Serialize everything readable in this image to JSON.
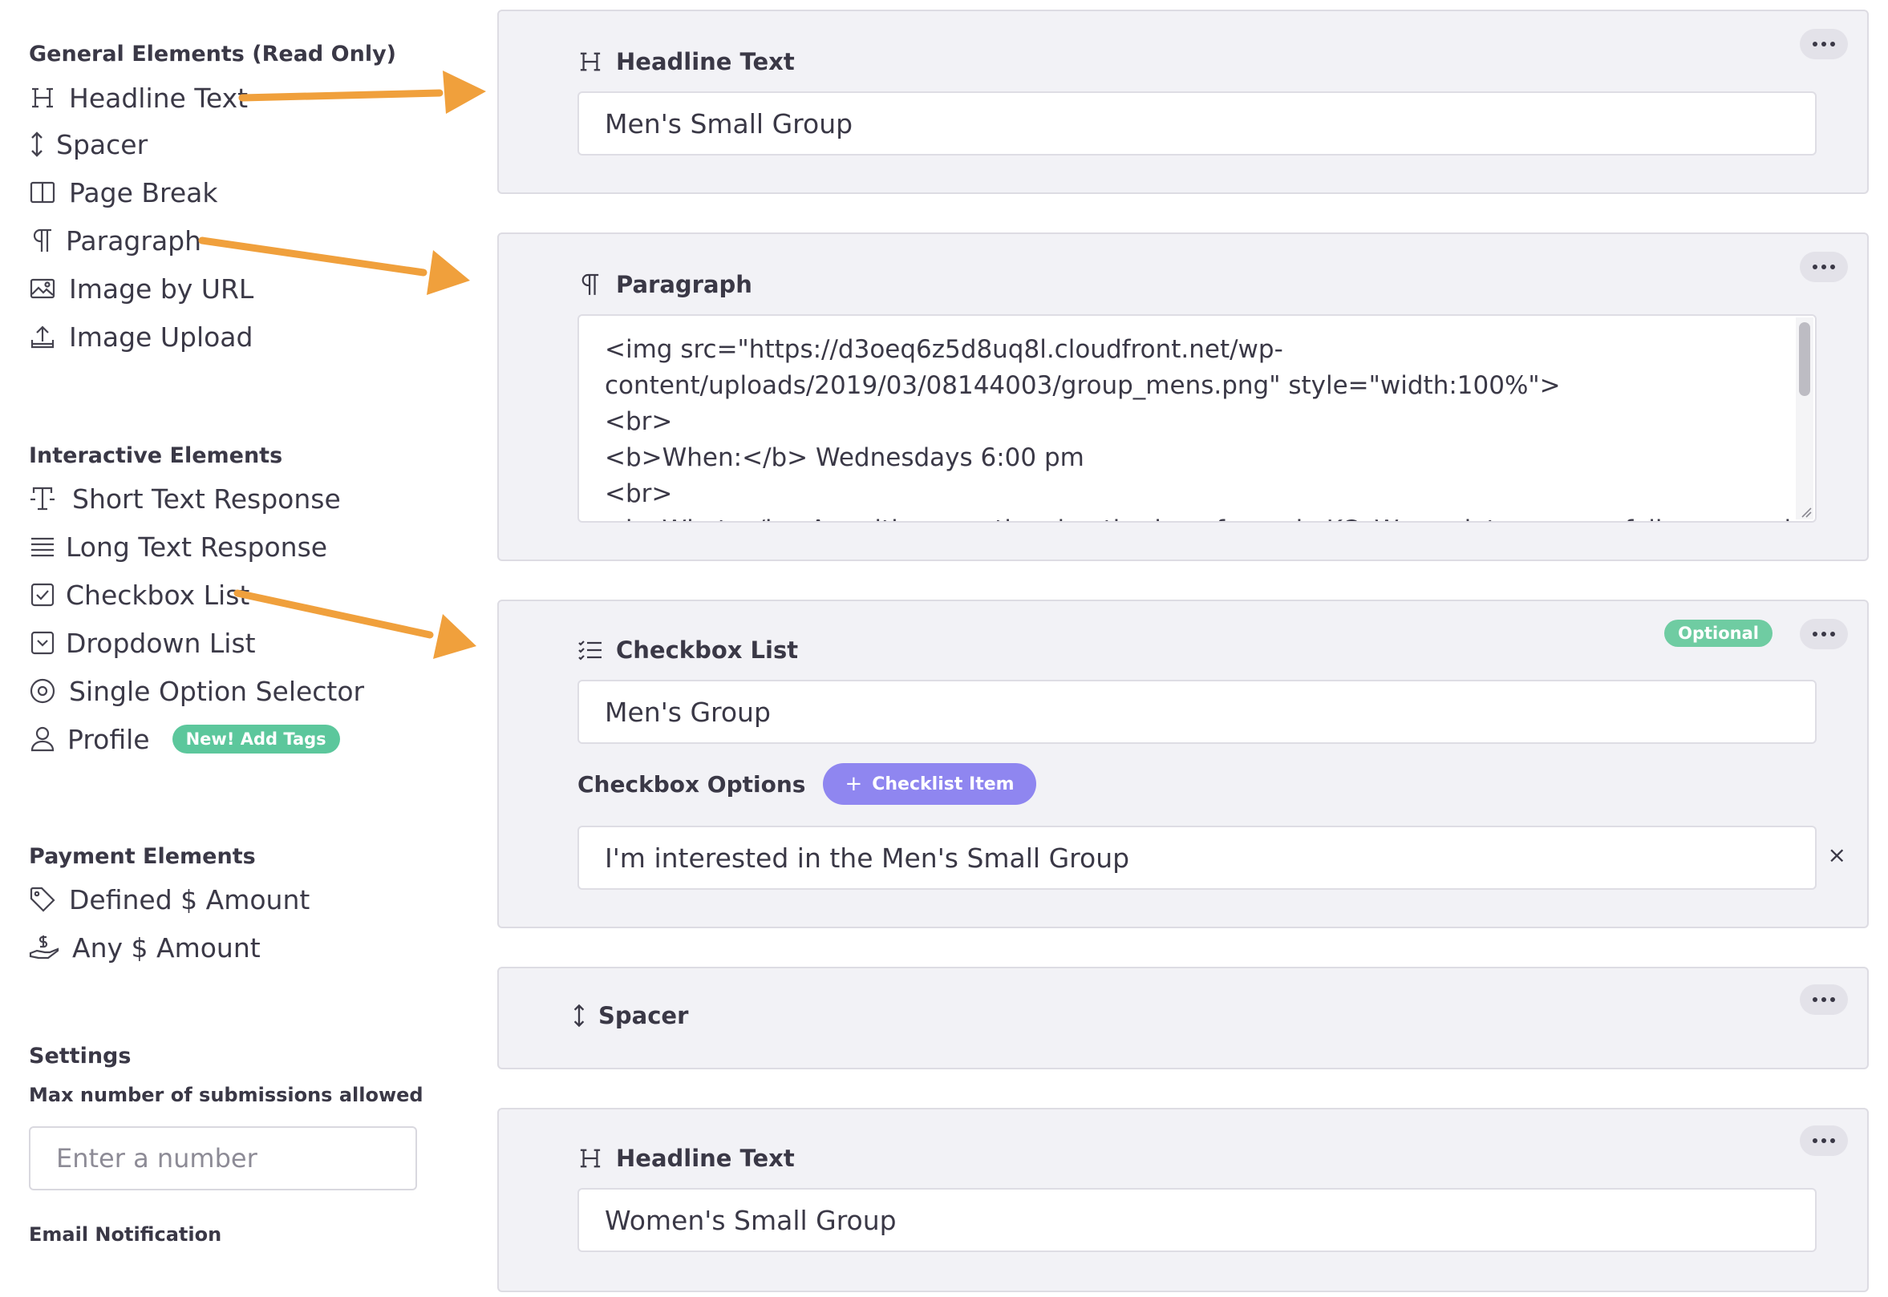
{
  "sidebar": {
    "general": {
      "title": "General Elements (Read Only)",
      "items": [
        {
          "label": "Headline Text",
          "icon": "heading-icon"
        },
        {
          "label": "Spacer",
          "icon": "vertical-arrows-icon"
        },
        {
          "label": "Page Break",
          "icon": "page-break-icon"
        },
        {
          "label": "Paragraph",
          "icon": "paragraph-icon"
        },
        {
          "label": "Image by URL",
          "icon": "image-icon"
        },
        {
          "label": "Image Upload",
          "icon": "upload-icon"
        }
      ]
    },
    "interactive": {
      "title": "Interactive Elements",
      "items": [
        {
          "label": "Short Text Response",
          "icon": "short-text-icon"
        },
        {
          "label": "Long Text Response",
          "icon": "lines-icon"
        },
        {
          "label": "Checkbox List",
          "icon": "checkbox-icon"
        },
        {
          "label": "Dropdown List",
          "icon": "dropdown-icon"
        },
        {
          "label": "Single Option Selector",
          "icon": "radio-icon"
        },
        {
          "label": "Profile",
          "icon": "user-icon",
          "badge": "New! Add Tags"
        }
      ]
    },
    "payment": {
      "title": "Payment Elements",
      "items": [
        {
          "label": "Defined $ Amount",
          "icon": "tag-icon"
        },
        {
          "label": "Any $ Amount",
          "icon": "hand-money-icon"
        }
      ]
    },
    "settings": {
      "title": "Settings",
      "max_label": "Max number of submissions allowed",
      "max_placeholder": "Enter a number",
      "email_label": "Email Notification"
    }
  },
  "cards": {
    "headline1": {
      "title": "Headline Text",
      "value": "Men's Small Group"
    },
    "paragraph": {
      "title": "Paragraph",
      "value": "<img src=\"https://d3oeq6z5d8uq8l.cloudfront.net/wp-\ncontent/uploads/2019/03/08144003/group_mens.png\" style=\"width:100%\">\n<br>\n<b>When:</b> Wednesdays 6:00 pm\n<br>\n<b>What:</b> A multi-generational gathering of men in KC. We seek to grow as followers and"
    },
    "checkbox": {
      "title": "Checkbox List",
      "badge": "Optional",
      "value": "Men's Group",
      "options_label": "Checkbox Options",
      "add_button": "Checklist Item",
      "options": [
        "I'm interested in the Men's Small Group"
      ],
      "remove_symbol": "×"
    },
    "spacer": {
      "title": "Spacer"
    },
    "headline2": {
      "title": "Headline Text",
      "value": "Women's Small Group"
    }
  },
  "colors": {
    "arrow": "#f0a03c",
    "card_bg": "#f2f2f6",
    "accent_purple": "#8f86f0",
    "accent_green": "#5cc79c"
  }
}
